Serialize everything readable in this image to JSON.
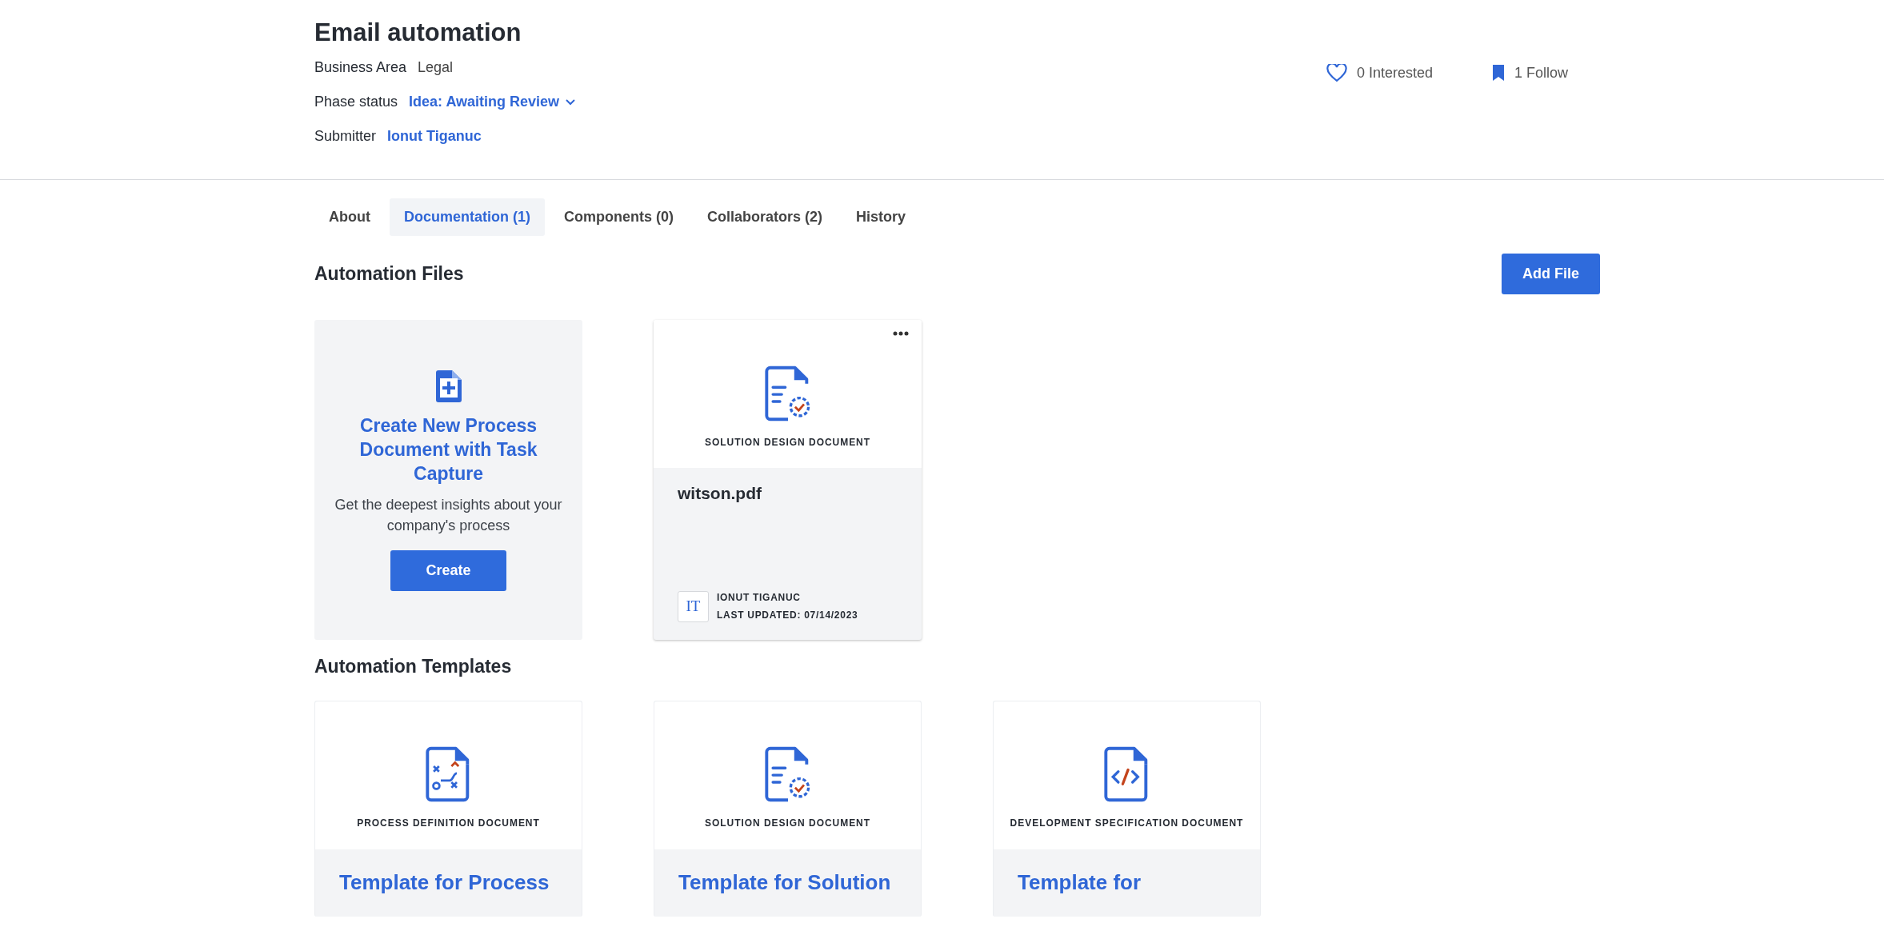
{
  "header": {
    "title": "Email automation",
    "fields": [
      {
        "label": "Business Area",
        "value": "Legal",
        "kind": "text"
      },
      {
        "label": "Phase status",
        "value": "Idea: Awaiting Review",
        "kind": "dropdown"
      },
      {
        "label": "Submitter",
        "value": "Ionut Tiganuc",
        "kind": "link"
      }
    ],
    "interested": "0 Interested",
    "follow": "1 Follow"
  },
  "tabs": [
    {
      "label": "About",
      "selected": false
    },
    {
      "label": "Documentation (1)",
      "selected": true
    },
    {
      "label": "Components (0)",
      "selected": false
    },
    {
      "label": "Collaborators (2)",
      "selected": false
    },
    {
      "label": "History",
      "selected": false
    }
  ],
  "files": {
    "heading": "Automation Files",
    "add_button": "Add File",
    "create_card": {
      "title": "Create New Process Document with Task Capture",
      "description": "Get the deepest insights about your company's process",
      "button": "Create"
    },
    "documents": [
      {
        "kind": "solution",
        "type_label": "SOLUTION DESIGN DOCUMENT",
        "name": "witson.pdf",
        "avatar": "IT",
        "author": "IONUT TIGANUC",
        "updated": "LAST UPDATED: 07/14/2023"
      }
    ]
  },
  "templates": {
    "heading": "Automation Templates",
    "items": [
      {
        "kind": "process",
        "type_label": "PROCESS DEFINITION DOCUMENT",
        "title": "Template for Process"
      },
      {
        "kind": "solution",
        "type_label": "SOLUTION DESIGN DOCUMENT",
        "title": "Template for Solution"
      },
      {
        "kind": "development",
        "type_label": "DEVELOPMENT SPECIFICATION DOCUMENT",
        "title": "Template for"
      }
    ]
  }
}
